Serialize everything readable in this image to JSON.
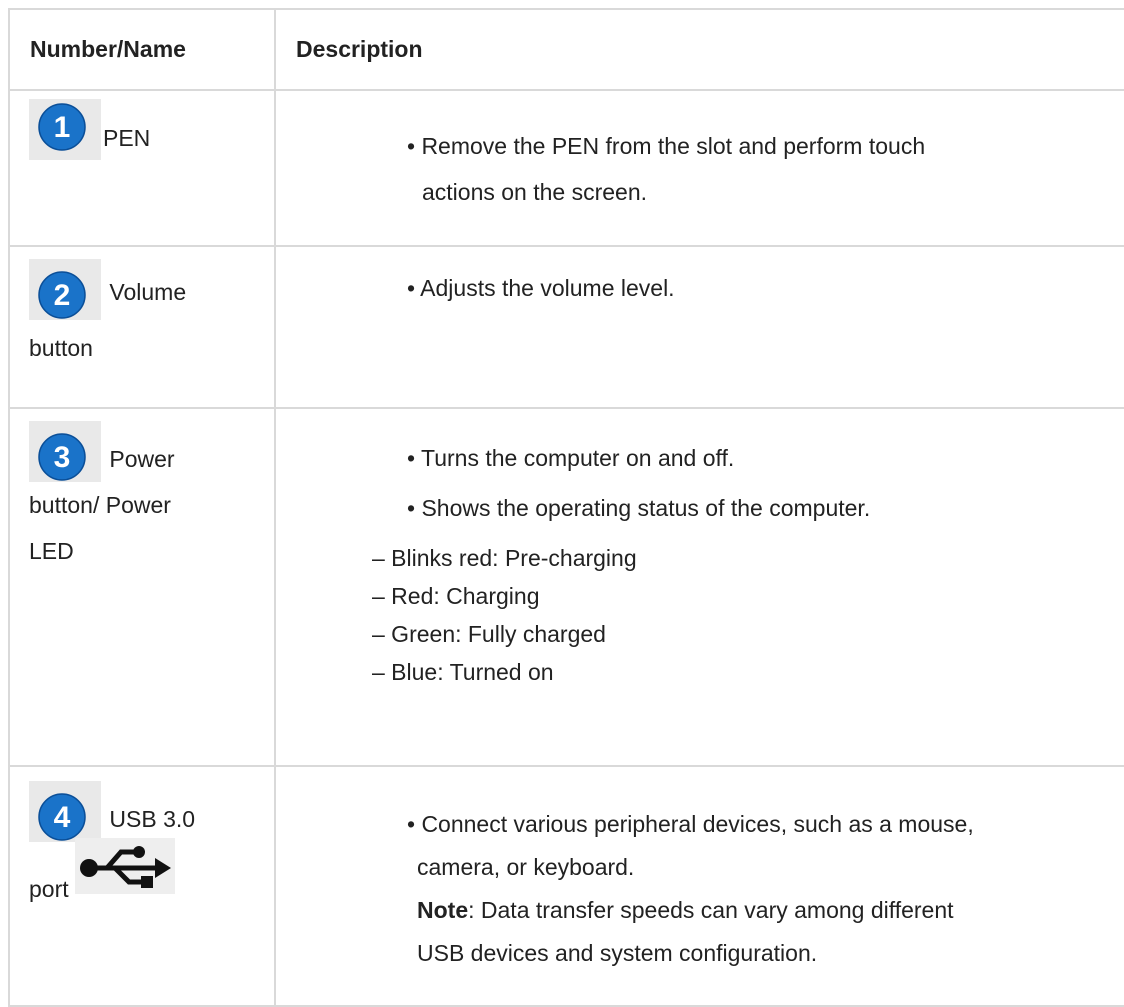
{
  "header": {
    "col1": "Number/Name",
    "col2": "Description"
  },
  "rows": [
    {
      "number": "1",
      "name_lines": [
        "PEN"
      ],
      "desc": [
        "• Remove the PEN from the slot and perform touch",
        "actions on the screen."
      ]
    },
    {
      "number": "2",
      "name_lines": [
        "Volume",
        "button"
      ],
      "desc": [
        "• Adjusts the volume level."
      ]
    },
    {
      "number": "3",
      "name_lines": [
        "Power",
        "button/ Power",
        "LED"
      ],
      "desc": [
        "• Turns the computer on and off.",
        "• Shows the operating status of the computer."
      ],
      "status": [
        "– Blinks red: Pre-charging",
        "– Red: Charging",
        "– Green: Fully charged",
        "– Blue: Turned on"
      ]
    },
    {
      "number": "4",
      "name_lines": [
        "USB 3.0",
        "port"
      ],
      "desc": [
        "• Connect various peripheral devices, such as a mouse,",
        "camera, or keyboard."
      ],
      "note_label": "Note",
      "note_text": ": Data transfer speeds can vary among different",
      "note_cont": "USB devices and system configuration."
    }
  ],
  "icons": {
    "badge": "number-circle-icon",
    "usb": "usb-icon"
  },
  "colors": {
    "badge_blue": "#1a73c9",
    "border": "#d9d9d9"
  }
}
